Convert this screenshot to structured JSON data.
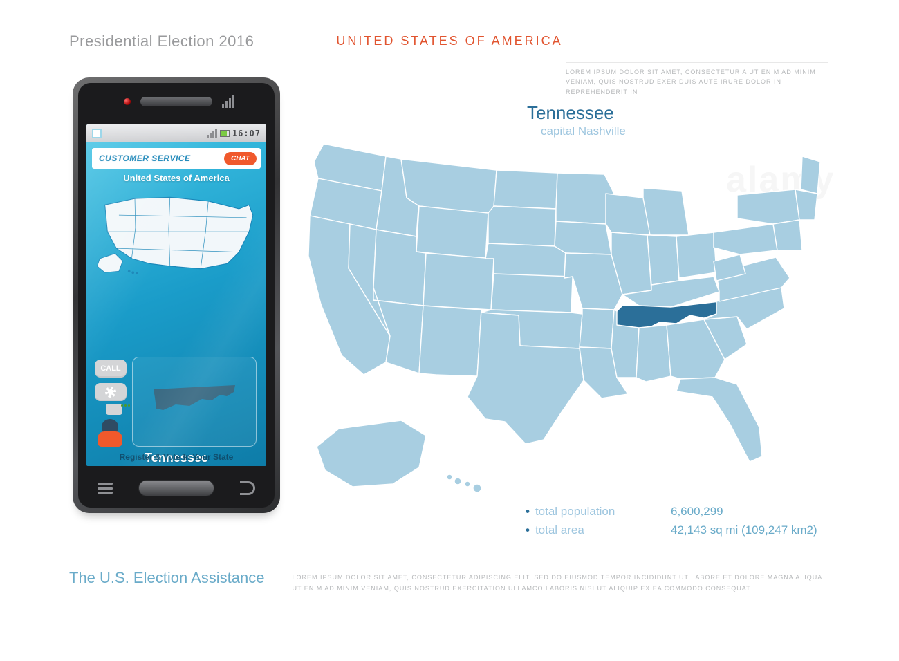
{
  "header": {
    "left": "Presidential Election 2016",
    "center": "United States of America"
  },
  "top_right_blurb": "Lorem ipsum dolor sit amet, consectetur a ut enim ad minim veniam, quis nostrud exer duis aute irure dolor in reprehenderit in",
  "state": {
    "name": "Tennessee",
    "capital_label": "capital Nashville"
  },
  "phone": {
    "status_time": "16:07",
    "cs_label": "CUSTOMER SERVICE",
    "cs_button": "CHAT",
    "country_label": "United States of America",
    "call_btn": "CALL",
    "state_name": "Tennessee",
    "register_line": "Register & Vote In Your State"
  },
  "stats": {
    "population_label": "total population",
    "population_value": "6,600,299",
    "area_label": "total area",
    "area_value": "42,143 sq mi (109,247 km2)"
  },
  "footer": {
    "title": "The U.S. Election Assistance",
    "text": "Lorem ipsum dolor sit amet, consectetur adipiscing elit, sed do eiusmod tempor incididunt ut labore et dolore magna aliqua. Ut enim ad minim veniam, quis nostrud exercitation ullamco laboris nisi ut aliquip ex ea commodo consequat."
  },
  "map": {
    "highlighted_state": "Tennessee",
    "base_color": "#a8cee1",
    "highlight_color": "#2b6f99",
    "stroke": "#ffffff"
  }
}
